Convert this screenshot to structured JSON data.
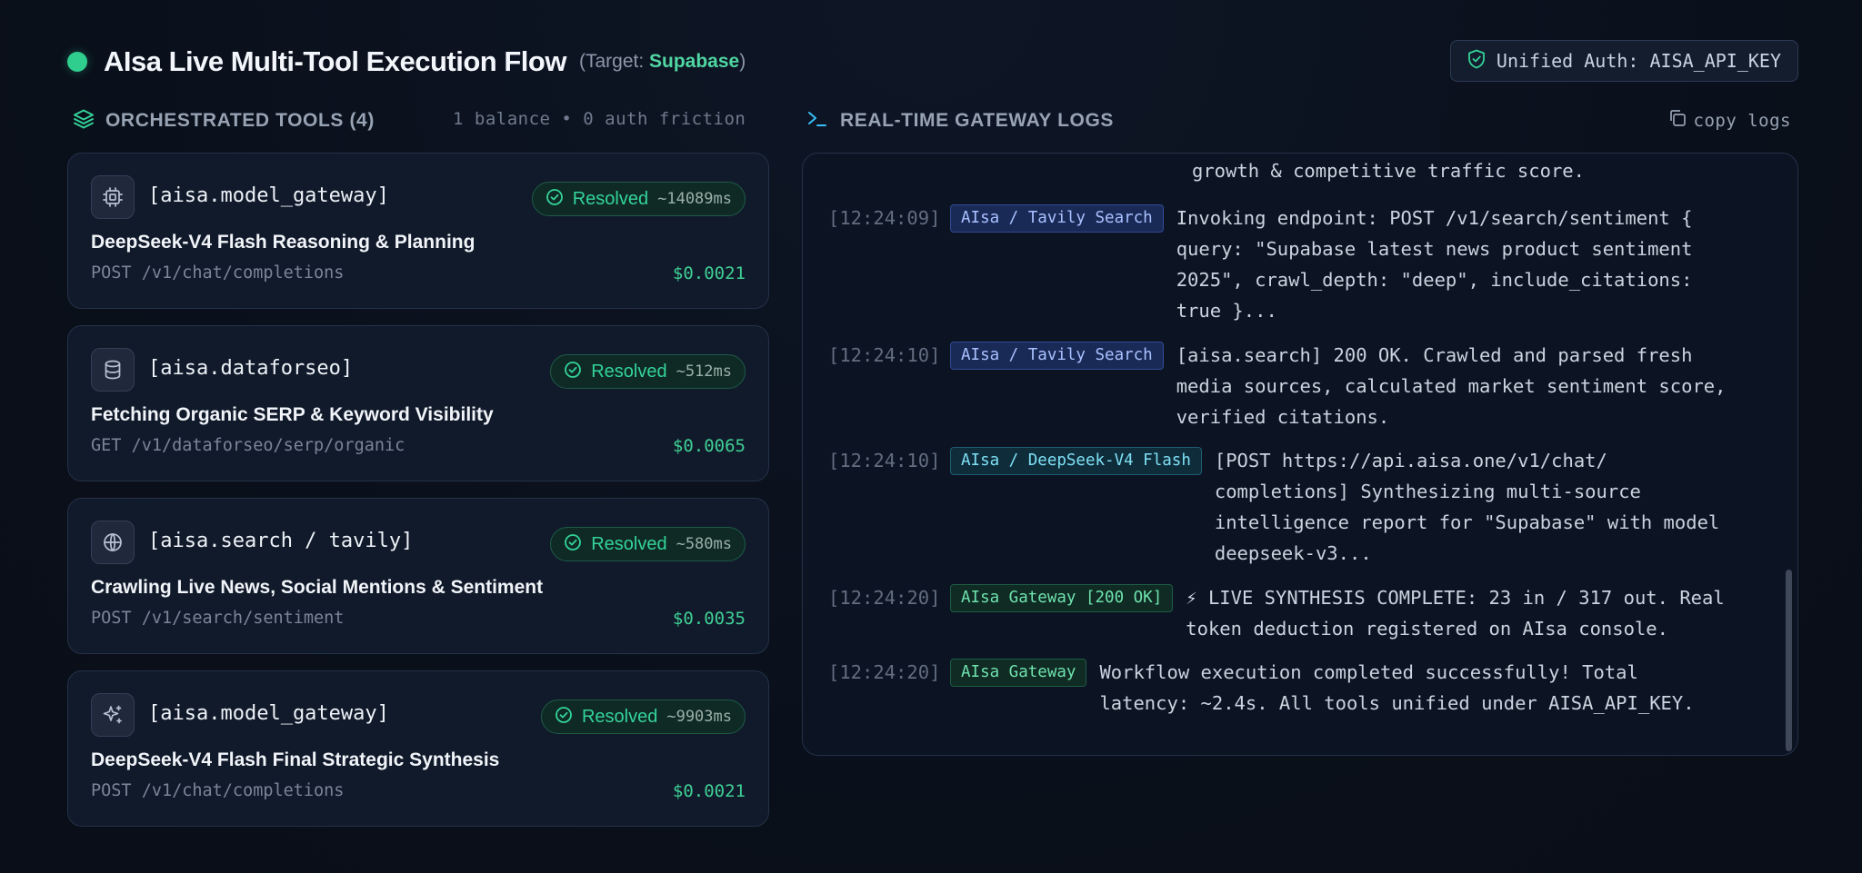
{
  "header": {
    "title": "AIsa Live Multi-Tool Execution Flow",
    "target_prefix": "(Target: ",
    "target_name": "Supabase",
    "target_suffix": ")",
    "auth_badge": "Unified Auth: AISA_API_KEY"
  },
  "tools_section": {
    "title": "ORCHESTRATED TOOLS (4)",
    "meta": "1 balance • 0 auth friction"
  },
  "logs_section": {
    "title": "REAL-TIME GATEWAY LOGS",
    "copy_label": "copy logs"
  },
  "tools": [
    {
      "icon": "cpu-icon",
      "name": "[aisa.model_gateway]",
      "status": "Resolved",
      "latency": "~14089ms",
      "description": "DeepSeek-V4 Flash Reasoning & Planning",
      "endpoint": "POST /v1/chat/completions",
      "cost": "$0.0021"
    },
    {
      "icon": "database-icon",
      "name": "[aisa.dataforseo]",
      "status": "Resolved",
      "latency": "~512ms",
      "description": "Fetching Organic SERP & Keyword Visibility",
      "endpoint": "GET /v1/dataforseo/serp/organic",
      "cost": "$0.0065"
    },
    {
      "icon": "globe-icon",
      "name": "[aisa.search / tavily]",
      "status": "Resolved",
      "latency": "~580ms",
      "description": "Crawling Live News, Social Mentions & Sentiment",
      "endpoint": "POST /v1/search/sentiment",
      "cost": "$0.0035"
    },
    {
      "icon": "sparkles-icon",
      "name": "[aisa.model_gateway]",
      "status": "Resolved",
      "latency": "~9903ms",
      "description": "DeepSeek-V4 Flash Final Strategic Synthesis",
      "endpoint": "POST /v1/chat/completions",
      "cost": "$0.0021"
    }
  ],
  "logs": {
    "partial_top": "growth & competitive traffic score.",
    "entries": [
      {
        "time": "[12:24:09]",
        "tag": "AIsa / Tavily Search",
        "tag_color": "blue",
        "lines": [
          "Invoking endpoint: POST /v1/search/sentiment {",
          "query: \"Supabase latest news product sentiment",
          "2025\", crawl_depth: \"deep\", include_citations:",
          "true }..."
        ]
      },
      {
        "time": "[12:24:10]",
        "tag": "AIsa / Tavily Search",
        "tag_color": "blue",
        "lines": [
          "[aisa.search] 200 OK. Crawled and parsed fresh",
          "media sources, calculated market sentiment score,",
          "verified citations."
        ]
      },
      {
        "time": "[12:24:10]",
        "tag": "AIsa / DeepSeek-V4 Flash",
        "tag_color": "cyan",
        "lines": [
          "[POST https://api.aisa.one/v1/chat/",
          "completions] Synthesizing multi-source",
          "intelligence report for \"Supabase\" with model",
          "deepseek-v3..."
        ]
      },
      {
        "time": "[12:24:20]",
        "tag": "AIsa Gateway [200 OK]",
        "tag_color": "green",
        "lines": [
          "⚡ LIVE SYNTHESIS COMPLETE: 23 in / 317 out. Real",
          "token deduction registered on AIsa console."
        ]
      },
      {
        "time": "[12:24:20]",
        "tag": "AIsa Gateway",
        "tag_color": "green",
        "lines": [
          "Workflow execution completed successfully! Total",
          "latency: ~2.4s. All tools unified under AISA_API_KEY."
        ]
      }
    ]
  },
  "colors": {
    "accent_green": "#34d399",
    "status_dot": "#2fce8e",
    "tag_blue": "#a9c1ff",
    "tag_cyan": "#7ee0f5",
    "tag_green": "#6fe2ae"
  }
}
